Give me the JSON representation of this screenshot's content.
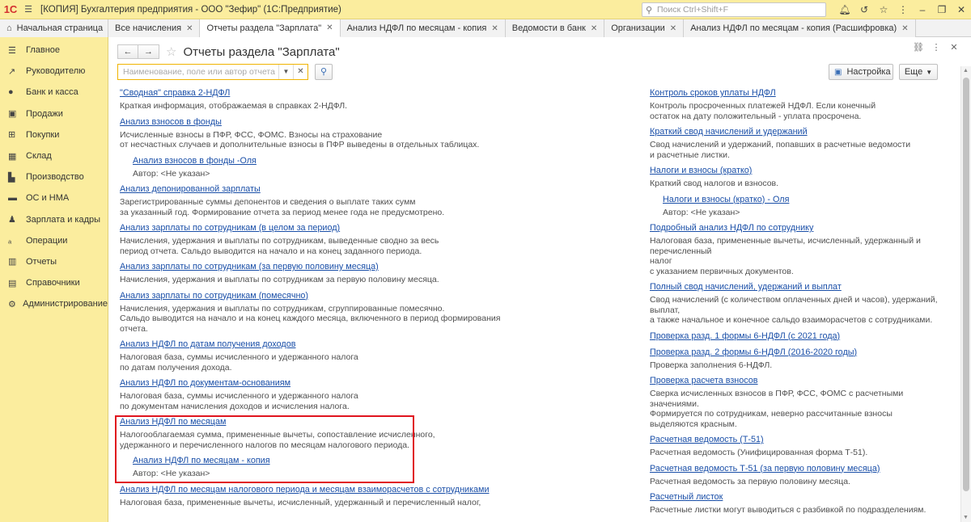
{
  "titlebar": {
    "app_title": "[КОПИЯ] Бухгалтерия предприятия - ООО \"Зефир\"  (1С:Предприятие)",
    "logo_text": "1С",
    "search_placeholder": "Поиск Ctrl+Shift+F"
  },
  "tabs": [
    {
      "label": "Начальная страница"
    },
    {
      "label": "Все начисления"
    },
    {
      "label": "Отчеты раздела \"Зарплата\""
    },
    {
      "label": "Анализ НДФЛ по месяцам - копия"
    },
    {
      "label": "Ведомости в банк"
    },
    {
      "label": "Организации"
    },
    {
      "label": "Анализ НДФЛ по месяцам - копия (Расшифровка)"
    }
  ],
  "sidebar": {
    "items": [
      {
        "label": "Главное"
      },
      {
        "label": "Руководителю"
      },
      {
        "label": "Банк и касса"
      },
      {
        "label": "Продажи"
      },
      {
        "label": "Покупки"
      },
      {
        "label": "Склад"
      },
      {
        "label": "Производство"
      },
      {
        "label": "ОС и НМА"
      },
      {
        "label": "Зарплата и кадры"
      },
      {
        "label": "Операции"
      },
      {
        "label": "Отчеты"
      },
      {
        "label": "Справочники"
      },
      {
        "label": "Администрирование"
      }
    ]
  },
  "main": {
    "title": "Отчеты раздела \"Зарплата\"",
    "filter_placeholder": "Наименование, поле или автор отчета",
    "settings_label": "Настройка",
    "more_label": "Еще",
    "left_reports": [
      {
        "title": "\"Сводная\" справка 2-НДФЛ",
        "desc": [
          "Краткая информация, отображаемая в справках 2-НДФЛ."
        ]
      },
      {
        "title": "Анализ взносов в фонды",
        "desc": [
          "Исчисленные взносы в ПФР, ФСС, ФОМС. Взносы на страхование",
          "от несчастных случаев и дополнительные взносы в ПФР выведены в отдельных таблицах."
        ],
        "variant": {
          "title": "Анализ взносов в фонды -Оля",
          "author": "Автор: <Не указан>"
        }
      },
      {
        "title": "Анализ депонированной зарплаты",
        "desc": [
          "Зарегистрированные суммы депонентов и сведения о выплате таких сумм",
          "за указанный год. Формирование отчета за период менее года не предусмотрено."
        ]
      },
      {
        "title": "Анализ зарплаты по сотрудникам (в целом за период)",
        "desc": [
          "Начисления, удержания и выплаты по сотрудникам, выведенные сводно за весь",
          "период отчета. Сальдо выводится на начало и на конец заданного периода."
        ]
      },
      {
        "title": "Анализ зарплаты по сотрудникам (за первую половину месяца)",
        "desc": [
          "Начисления, удержания и выплаты по сотрудникам за первую половину месяца."
        ]
      },
      {
        "title": "Анализ зарплаты по сотрудникам (помесячно)",
        "desc": [
          "Начисления, удержания и выплаты по сотрудникам, сгруппированные помесячно.",
          "Сальдо выводится на начало и на конец каждого месяца, включенного в период формирования отчета."
        ]
      },
      {
        "title": "Анализ НДФЛ по датам получения доходов",
        "desc": [
          "Налоговая база, суммы исчисленного и удержанного налога",
          "по датам получения дохода."
        ]
      },
      {
        "title": "Анализ НДФЛ по документам-основаниям",
        "desc": [
          "Налоговая база, суммы исчисленного и удержанного налога",
          "по документам начисления доходов и исчисления налога."
        ]
      },
      {
        "title": "Анализ НДФЛ по месяцам",
        "desc": [
          "Налогооблагаемая сумма, примененные вычеты, сопоставление исчисленного,",
          "удержанного и перечисленного налогов по месяцам налогового периода."
        ],
        "variant": {
          "title": "Анализ НДФЛ по месяцам - копия",
          "author": "Автор: <Не указан>"
        }
      },
      {
        "title": "Анализ НДФЛ по месяцам налогового периода и месяцам взаиморасчетов с сотрудниками",
        "desc": [
          "Налоговая база, примененные вычеты, исчисленный, удержанный и перечисленный налог,"
        ]
      }
    ],
    "right_reports": [
      {
        "title": "Контроль сроков уплаты НДФЛ",
        "desc": [
          "Контроль просроченных платежей НДФЛ. Если конечный",
          "остаток на дату положительный - уплата просрочена."
        ]
      },
      {
        "title": "Краткий свод начислений и удержаний",
        "desc": [
          "Свод начислений и удержаний, попавших в расчетные ведомости",
          "и расчетные листки."
        ]
      },
      {
        "title": "Налоги и взносы (кратко)",
        "desc": [
          "Краткий свод налогов и взносов."
        ],
        "variant": {
          "title": "Налоги и взносы (кратко) - Оля",
          "author": "Автор: <Не указан>"
        }
      },
      {
        "title": "Подробный анализ НДФЛ по сотруднику",
        "desc": [
          "Налоговая база, примененные вычеты, исчисленный, удержанный и перечисленный",
          "налог",
          "с указанием первичных документов."
        ]
      },
      {
        "title": "Полный свод начислений, удержаний и выплат",
        "desc": [
          "Свод начислений (с количеством оплаченных дней и часов), удержаний, выплат,",
          "а также начальное и конечное сальдо взаиморасчетов с сотрудниками."
        ]
      },
      {
        "title": "Проверка разд. 1 формы 6-НДФЛ (с 2021 года)",
        "desc": []
      },
      {
        "title": "Проверка разд. 2 формы 6-НДФЛ (2016-2020 годы)",
        "desc": [
          "Проверка заполнения 6-НДФЛ."
        ]
      },
      {
        "title": "Проверка расчета взносов",
        "desc": [
          "Сверка исчисленных взносов в ПФР, ФСС, ФОМС с расчетными",
          "значениями.",
          "Формируется по сотрудникам, неверно рассчитанные взносы",
          "выделяются красным."
        ]
      },
      {
        "title": "Расчетная ведомость (Т-51)",
        "desc": [
          "Расчетная ведомость (Унифицированная форма Т-51)."
        ]
      },
      {
        "title": "Расчетная ведомость Т-51 (за первую половину месяца)",
        "desc": [
          "Расчетная ведомость за первую половину месяца."
        ]
      },
      {
        "title": "Расчетный листок",
        "desc": [
          "Расчетные листки могут выводиться с разбивкой по подразделениям."
        ]
      }
    ]
  },
  "colors": {
    "sidebar_bg": "#fbed9e",
    "link": "#1a4fa8",
    "highlight_border": "#e0141e",
    "filter_border": "#f0b400"
  }
}
